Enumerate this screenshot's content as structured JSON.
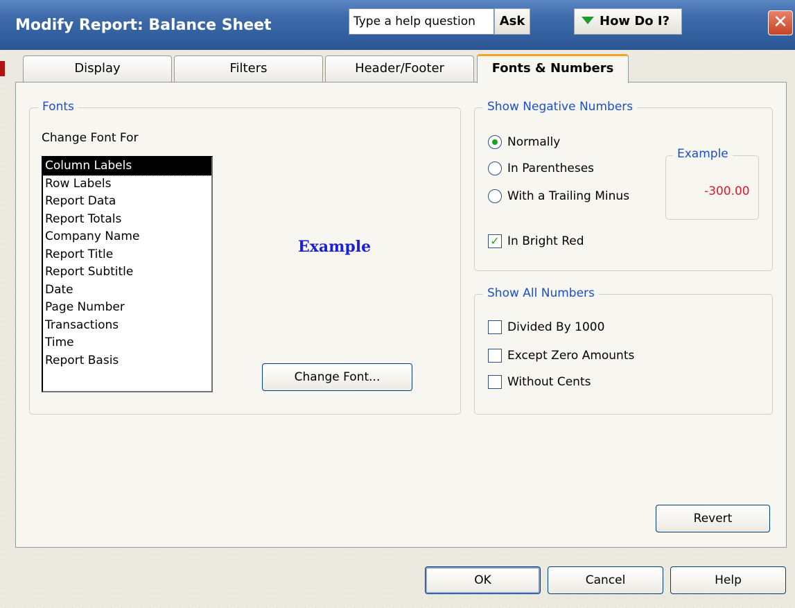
{
  "window": {
    "title": "Modify Report: Balance Sheet",
    "help_placeholder": "Type a help question",
    "ask_label": "Ask",
    "howdoi_label": "How Do I?",
    "close_glyph": "✕"
  },
  "tabs": [
    {
      "label": "Display",
      "active": false
    },
    {
      "label": "Filters",
      "active": false
    },
    {
      "label": "Header/Footer",
      "active": false
    },
    {
      "label": "Fonts & Numbers",
      "active": true
    }
  ],
  "fonts": {
    "group_label": "Fonts",
    "change_font_for_label": "Change Font For",
    "list_items": [
      "Column Labels",
      "Row Labels",
      "Report Data",
      "Report Totals",
      "Company Name",
      "Report Title",
      "Report Subtitle",
      "Date",
      "Page Number",
      "Transactions",
      "Time",
      "Report Basis"
    ],
    "selected_index": 0,
    "example_text": "Example",
    "change_font_button": "Change Font..."
  },
  "negative_numbers": {
    "group_label": "Show Negative Numbers",
    "options": [
      {
        "label": "Normally",
        "checked": true
      },
      {
        "label": "In Parentheses",
        "checked": false
      },
      {
        "label": "With a Trailing Minus",
        "checked": false
      }
    ],
    "example_label": "Example",
    "example_value": "-300.00",
    "bright_red_label": "In Bright Red",
    "bright_red_checked": true
  },
  "all_numbers": {
    "group_label": "Show All Numbers",
    "options": [
      {
        "label": "Divided By 1000",
        "checked": false
      },
      {
        "label": "Except Zero Amounts",
        "checked": false
      },
      {
        "label": "Without Cents",
        "checked": false
      }
    ]
  },
  "buttons": {
    "revert": "Revert",
    "ok": "OK",
    "cancel": "Cancel",
    "help": "Help"
  },
  "colors": {
    "group_label": "#1c4ecc",
    "negative_red": "#e2172a",
    "example_blue": "#1a20d8",
    "active_tab_accent": "#f2a322"
  }
}
